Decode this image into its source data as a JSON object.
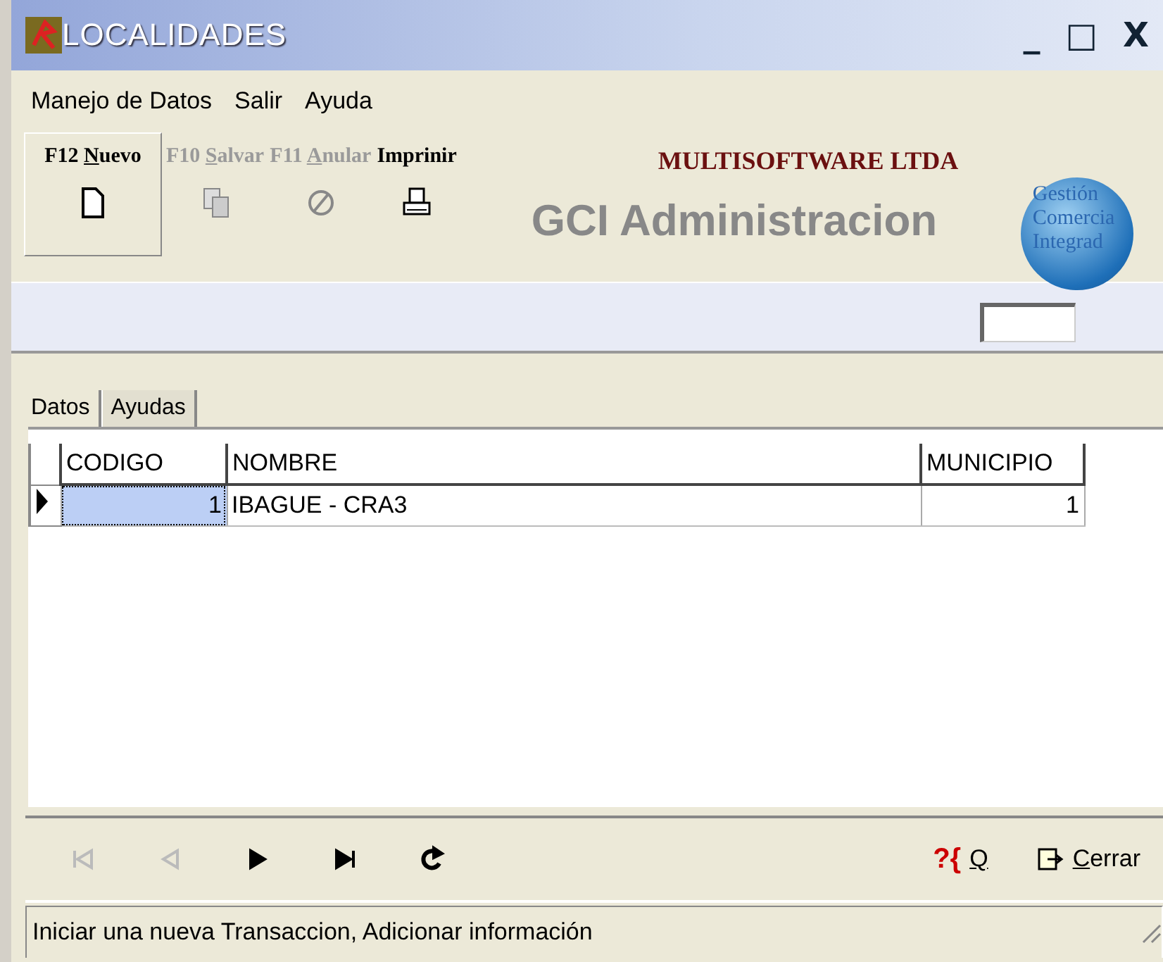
{
  "window": {
    "title": "LOCALIDADES",
    "controls": [
      {
        "kind": "minimize",
        "label": "_"
      },
      {
        "kind": "maximize",
        "label": "□"
      },
      {
        "kind": "close",
        "label": "X"
      }
    ]
  },
  "menu": [
    "Manejo de Datos",
    "Salir",
    "Ayuda"
  ],
  "toolbar": [
    {
      "key": "F12",
      "label": "Nuevo",
      "mnemonic": true,
      "disabled": false,
      "pressed": true,
      "kind": "new"
    },
    {
      "key": "F10",
      "label": "Salvar",
      "mnemonic": true,
      "disabled": true,
      "pressed": false,
      "kind": "save"
    },
    {
      "key": "F11",
      "label": "Anular",
      "mnemonic": true,
      "disabled": true,
      "pressed": false,
      "kind": "cancel"
    },
    {
      "label": "Imprinir",
      "mnemonic": false,
      "disabled": false,
      "pressed": false,
      "kind": "print"
    }
  ],
  "branding": {
    "company": "MULTISOFTWARE LTDA",
    "product": "GCI Administracion",
    "logo_lines": [
      "Gestión",
      "Comercia",
      "Integrad"
    ]
  },
  "tabs": [
    {
      "label": "Datos",
      "selected": true
    },
    {
      "label": "Ayudas",
      "selected": false
    }
  ],
  "table": {
    "columns": [
      "CODIGO",
      "NOMBRE",
      "MUNICIPIO"
    ],
    "rows": [
      {
        "cells": [
          "1",
          "IBAGUE - CRA3",
          "1"
        ],
        "selected": true
      }
    ]
  },
  "navigator": [
    {
      "kind": "first",
      "disabled": true
    },
    {
      "kind": "prev",
      "disabled": true
    },
    {
      "kind": "next",
      "disabled": false
    },
    {
      "kind": "last",
      "disabled": false
    },
    {
      "kind": "refresh",
      "disabled": false
    }
  ],
  "query_button": {
    "icon": "?{",
    "label": "Q"
  },
  "close_button": {
    "label": "Cerrar"
  },
  "status_bar": "Iniciar una nueva Transaccion, Adicionar información"
}
